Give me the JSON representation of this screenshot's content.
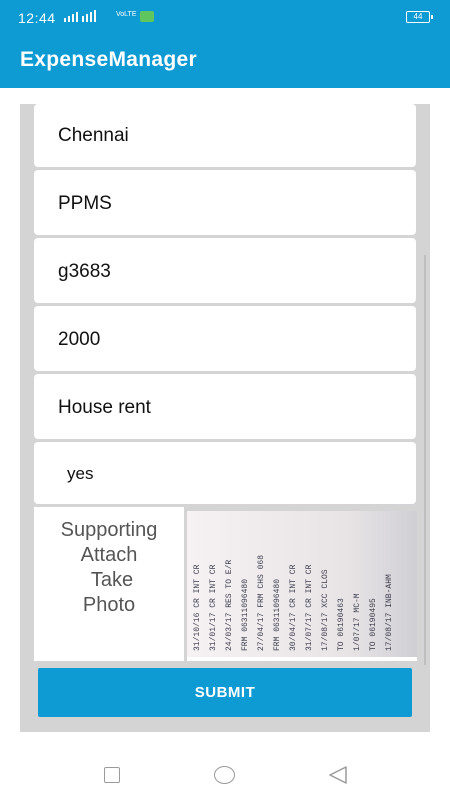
{
  "status_bar": {
    "time": "12:44",
    "network": "VoLTE",
    "battery": "44"
  },
  "app": {
    "title": "ExpenseManager"
  },
  "form": {
    "fields": [
      {
        "value": "Chennai"
      },
      {
        "value": "PPMS"
      },
      {
        "value": "g3683"
      },
      {
        "value": "2000"
      },
      {
        "value": "House rent"
      },
      {
        "value": "yes"
      }
    ],
    "attachment": {
      "label_line1": "Supporting",
      "label_line2": "Attach",
      "label_line3": "Take",
      "label_line4": "Photo",
      "photo_text": [
        "31/10/16  CR INT CR",
        "31/01/17  CR INT CR",
        "24/03/17  RES TO E/R",
        "FRM 06311096480",
        "27/04/17  FRM CHS 068",
        "FRM 06311096480",
        "30/04/17  CR INT CR",
        "31/07/17  CR INT CR",
        "17/08/17  XCC CLOS",
        "TO 06190463",
        "1/07/17  MC-M",
        "TO 06190495",
        "17/08/17  INB-AHM"
      ]
    },
    "submit_label": "SUBMIT"
  },
  "nav": {
    "items": [
      "recent-apps",
      "home",
      "back"
    ]
  },
  "colors": {
    "primary": "#0e9ad3",
    "background": "#d4d4d4",
    "field": "#ffffff"
  }
}
